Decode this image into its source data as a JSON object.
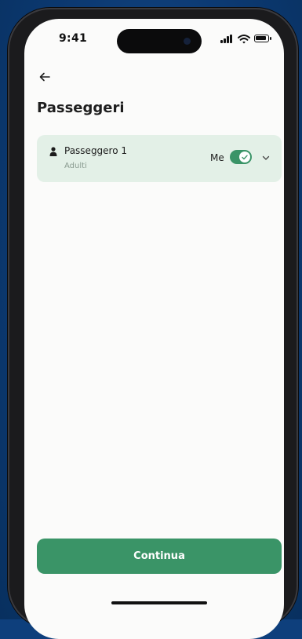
{
  "status_bar": {
    "time": "9:41"
  },
  "header": {
    "back_icon": "arrow-left-icon",
    "title": "Passeggeri"
  },
  "passenger_card": {
    "name": "Passeggero 1",
    "type": "Adulti",
    "me_label": "Me",
    "me_toggle_on": true,
    "person_icon": "person-icon",
    "expand_icon": "chevron-down-icon"
  },
  "footer": {
    "continue_label": "Continua"
  },
  "colors": {
    "accent": "#3a9467",
    "card_bg": "#e3f0e7",
    "screen_bg": "#fbfbfa",
    "background": "#0e3f7c"
  }
}
